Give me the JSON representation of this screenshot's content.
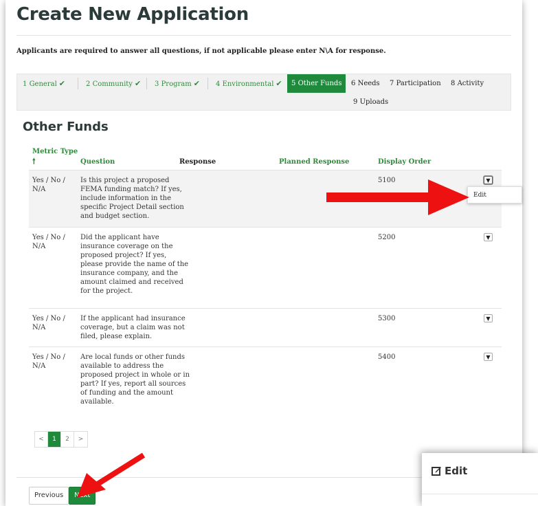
{
  "page": {
    "title": "Create New Application",
    "instructions": "Applicants are required to answer all questions, if not applicable please enter N\\A for response."
  },
  "steps": [
    {
      "num": "1",
      "label": "General",
      "state": "done"
    },
    {
      "num": "2",
      "label": "Community",
      "state": "done"
    },
    {
      "num": "3",
      "label": "Program",
      "state": "done"
    },
    {
      "num": "4",
      "label": "Environmental",
      "state": "done"
    },
    {
      "num": "5",
      "label": "Other Funds",
      "state": "active"
    },
    {
      "num": "6",
      "label": "Needs",
      "state": "todo"
    },
    {
      "num": "7",
      "label": "Participation",
      "state": "todo"
    },
    {
      "num": "8",
      "label": "Activity",
      "state": "todo"
    },
    {
      "num": "9",
      "label": "Uploads",
      "state": "todo"
    }
  ],
  "section": {
    "heading": "Other Funds"
  },
  "table": {
    "columns": {
      "metric_type": "Metric Type",
      "question": "Question",
      "response": "Response",
      "planned_response": "Planned Response",
      "display_order": "Display Order"
    },
    "rows": [
      {
        "metric_type": "Yes / No / N/A",
        "question": "Is this project a proposed FEMA funding match? If yes, include information in the specific Project Detail section and budget section.",
        "response": "",
        "planned_response": "",
        "display_order": "5100"
      },
      {
        "metric_type": "Yes / No / N/A",
        "question": "Did the applicant have insurance coverage on the proposed project? If yes, please provide the name of the insurance company, and the amount claimed and received for the project.",
        "response": "",
        "planned_response": "",
        "display_order": "5200"
      },
      {
        "metric_type": "Yes / No / N/A",
        "question": "If the applicant had insurance coverage, but a claim was not filed, please explain.",
        "response": "",
        "planned_response": "",
        "display_order": "5300"
      },
      {
        "metric_type": "Yes / No / N/A",
        "question": "Are local funds or other funds available to address the proposed project in whole or in part? If yes, report all sources of funding and the amount available.",
        "response": "",
        "planned_response": "",
        "display_order": "5400"
      }
    ],
    "row_menu": {
      "edit_label": "Edit"
    }
  },
  "pager": {
    "prev": "<",
    "pages": [
      "1",
      "2"
    ],
    "current": "1",
    "next": ">"
  },
  "footer": {
    "previous_label": "Previous",
    "next_label": "Next"
  },
  "modal": {
    "title": "Edit"
  },
  "colors": {
    "accent_green": "#1f8a3c",
    "annotation_red": "#ee1111"
  },
  "icons": {
    "sort": "arrow-up-icon",
    "row_menu": "chevron-down-icon",
    "done": "checkmark-icon",
    "modal": "edit-icon"
  }
}
